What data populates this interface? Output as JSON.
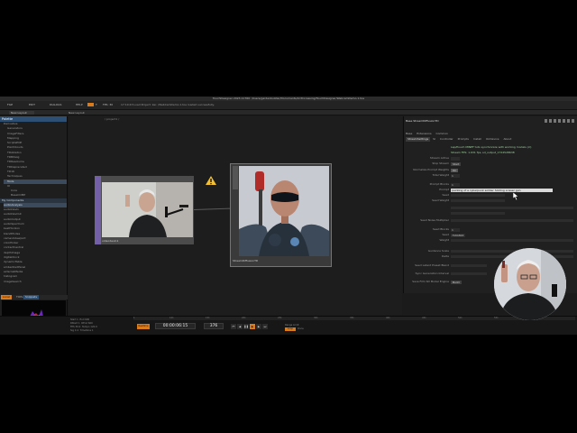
{
  "window": {
    "title": "TouchDesigner 2023.11760: /Users/gardenbuilder/Documents/AI Processing/TouchDesigner/WebcamDemo.1.toe"
  },
  "menu": {
    "items": [
      "FILE",
      "EDIT",
      "DIALOGS",
      "HELP"
    ],
    "controls": [
      "T",
      "FPS: 30"
    ],
    "status": "17:10:43 Load Project: ker. /WebCamDemo.1.toe loaded successfully."
  },
  "subbar": {
    "selector": "New Layout",
    "right": "New Layout"
  },
  "palette": {
    "header": "Palette",
    "items": [
      "Derivative",
      "Generators",
      "ImageFilters",
      "Mapping",
      "ScriptsPOP",
      "PointClouds",
      "TDAbleton",
      "TDBitwig",
      "TDResolume",
      "TDDeprecated",
      "TD16",
      "Techniques",
      "Tools",
      "UI",
      "Core",
      "BaseCOMP"
    ],
    "my_components": "My Components",
    "list": [
      "audioAnalysis",
      "audioDevIn",
      "audioDevOut",
      "audioOutput",
      "audioSpectrum",
      "bestHorizon",
      "blendModes",
      "cameraViewport",
      "colorPicker",
      "contactCentral",
      "depthImage",
      "digitalClock",
      "dynamicTable",
      "embeddedPanel",
      "externalMedia",
      "histogram",
      "imageSearch",
      "inSequencer"
    ],
    "tabs": [
      "Local",
      "TOPs",
      "Snippets"
    ]
  },
  "network": {
    "path": "/ project1 /",
    "nodes": [
      {
        "id": "webcam",
        "label": "videodevin1"
      },
      {
        "id": "stream",
        "label": "StreamDiffusionTD"
      }
    ],
    "warning": "!"
  },
  "params": {
    "title": "Base  StreamDiffusionTD",
    "tabs_top": [
      "Base",
      "Extensions",
      "Common"
    ],
    "tabs": [
      "StreamSettings",
      "SI",
      "Controller",
      "Prompts",
      "Install",
      "OnDevice",
      "About"
    ],
    "rows": [
      {
        "label": "",
        "value": "Lap/Pouch MINEF tuto synchronize with working models (cl)",
        "type": "text-green"
      },
      {
        "label": "",
        "value": "Stream FPS: 1.631 fps, sd_output_1724528638",
        "type": "text-green"
      },
      {
        "label": "Stream Active",
        "value": "",
        "type": "field"
      },
      {
        "label": "Stop Stream",
        "value": "Start",
        "type": "button"
      },
      {
        "label": "Normalize Prompt Weights",
        "value": "On",
        "type": "button"
      },
      {
        "label": "Total Weight",
        "value": "1",
        "type": "field"
      },
      {
        "label": "Prompt Blocks",
        "value": "1",
        "type": "field"
      },
      {
        "label": "Prompt",
        "value": "painting of a cyberpunk soldier holding a laser gun",
        "type": "prompt"
      },
      {
        "label": "Seed",
        "value": "",
        "type": "bar"
      },
      {
        "label": "Seed Weight",
        "value": "",
        "type": "bar"
      },
      {
        "label": "Seed Noise Multiplier",
        "value": "",
        "type": "bar"
      },
      {
        "label": "Seed Blocks",
        "value": "1",
        "type": "field"
      },
      {
        "label": "Seed",
        "value": "7684868",
        "type": "field"
      },
      {
        "label": "Weight",
        "value": "",
        "type": "bar"
      },
      {
        "label": "Guidance Scale",
        "value": "",
        "type": "bar"
      },
      {
        "label": "Delta",
        "value": "",
        "type": "bar"
      },
      {
        "label": "Seed Latent Preset Blend",
        "value": "",
        "type": "bar"
      },
      {
        "label": "Sync Generation Interval",
        "value": "",
        "type": "bar"
      },
      {
        "label": "Save Film SD Model Engine",
        "value": "Build",
        "type": "button"
      }
    ]
  },
  "timeline": {
    "ticks": [
      "1",
      "101",
      "151",
      "201",
      "251",
      "301",
      "351",
      "401",
      "451",
      "501",
      "551",
      "601"
    ],
    "timecode": "00:00:06:15",
    "frame": "376",
    "info_left": [
      "Start",
      "End",
      "RStart",
      "REnd",
      "FPS",
      "Tempo",
      "Sig",
      "TimeSlice"
    ],
    "info_vals": [
      "1",
      "600",
      "1",
      "600",
      "30.0",
      "120.0",
      "4 4",
      "1"
    ],
    "range": "Range Limit",
    "loop": "Loop",
    "once": "Once",
    "realtime": "Realtime"
  },
  "colors": {
    "accent": "#d97a1c",
    "active_node": "#3d9a3d",
    "palette_header": "#2d4f73"
  }
}
